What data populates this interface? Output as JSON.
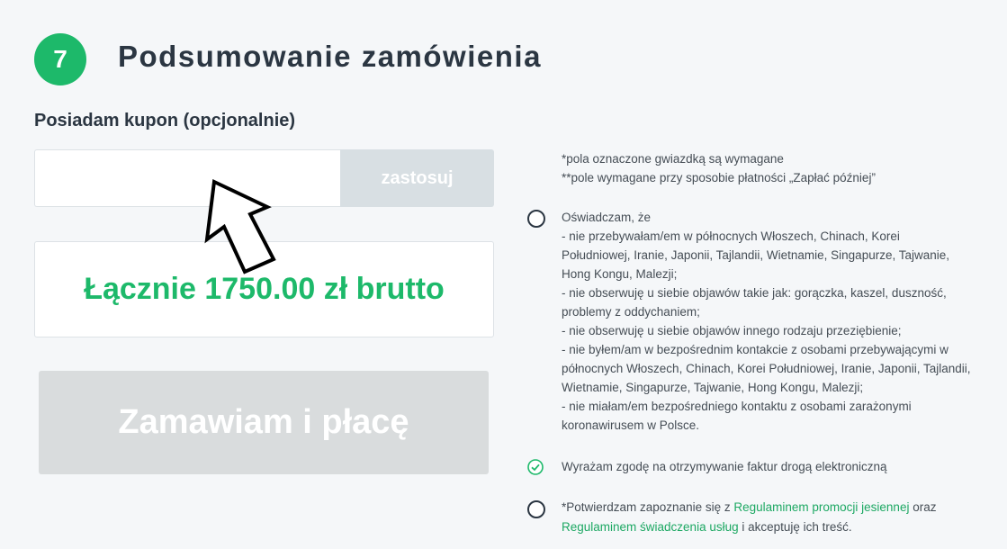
{
  "step": {
    "number": "7",
    "title": "Podsumowanie zamówienia"
  },
  "coupon": {
    "label": "Posiadam kupon (opcjonalnie)",
    "value": "",
    "placeholder": "",
    "apply_label": "zastosuj"
  },
  "total": {
    "text": "Łącznie 1750.00 zł brutto"
  },
  "order_button": {
    "label": "Zamawiam i płacę"
  },
  "notes": {
    "required": "*pola oznaczone gwiazdką są wymagane",
    "pay_later": "**pole wymagane przy sposobie płatności „Zapłać później”"
  },
  "declaration": {
    "checked": false,
    "lines": [
      "Oświadczam, że",
      "- nie przebywałam/em w północnych Włoszech, Chinach, Korei",
      "Południowej, Iranie, Japonii, Tajlandii, Wietnamie, Singapurze, Tajwanie,",
      "Hong Kongu, Malezji;",
      "- nie obserwuję u siebie objawów takie jak: gorączka, kaszel, duszność,",
      "problemy z oddychaniem;",
      "- nie obserwuję u siebie objawów innego rodzaju przeziębienie;",
      "- nie byłem/am w bezpośrednim kontakcie z osobami przebywającymi w",
      "północnych Włoszech, Chinach, Korei Południowej, Iranie, Japonii, Tajlandii,",
      "Wietnamie, Singapurze, Tajwanie, Hong Kongu, Malezji;",
      "- nie miałam/em bezpośredniego kontaktu z osobami zarażonymi",
      "koronawirusem w Polsce."
    ]
  },
  "invoice_consent": {
    "checked": true,
    "label": "Wyrażam zgodę na otrzymywanie faktur drogą elektroniczną"
  },
  "terms": {
    "checked": false,
    "prefix": "*Potwierdzam zapoznanie się z ",
    "link1": "Regulaminem promocji jesiennej",
    "middle": " oraz",
    "link2": "Regulaminem świadczenia usług",
    "suffix": " i akceptuję ich treść."
  },
  "colors": {
    "accent": "#1db96a",
    "link": "#1da863",
    "disabled_button": "#d9dcdd",
    "apply_button": "#d8dfe3",
    "background": "#f5f7f9"
  },
  "icons": [
    "cursor-arrow-icon",
    "check-icon"
  ]
}
